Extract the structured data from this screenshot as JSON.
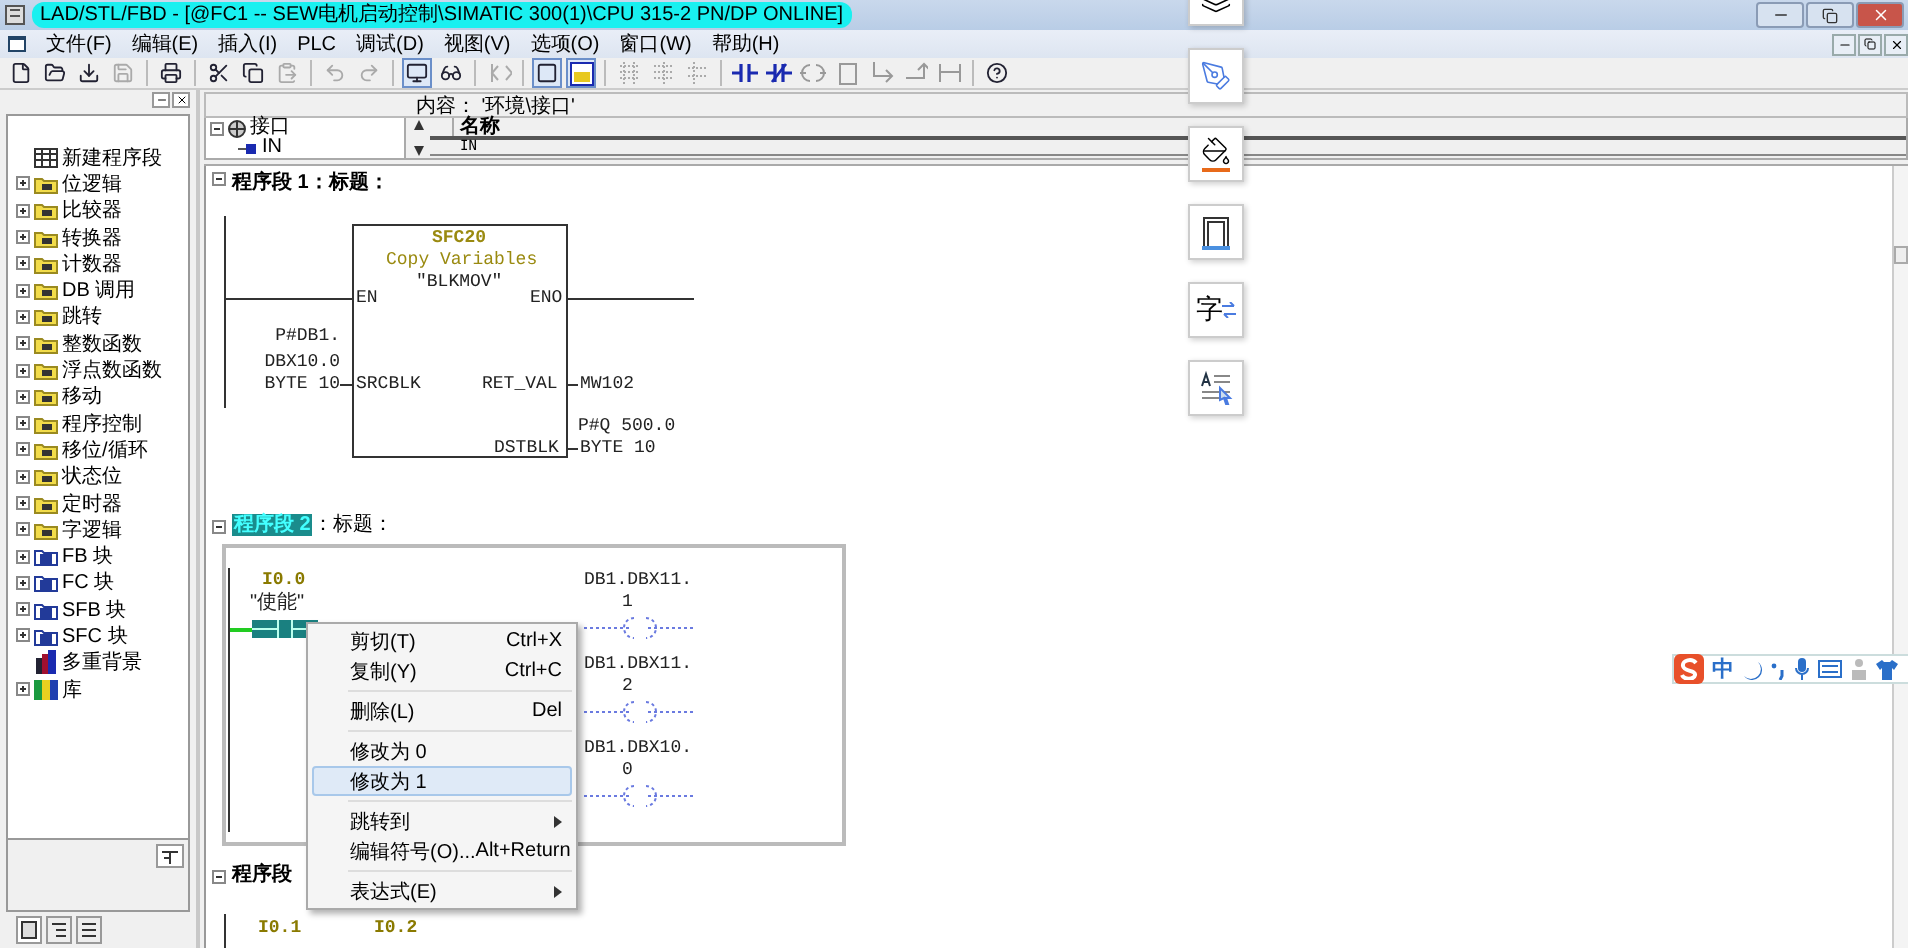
{
  "window": {
    "title": "LAD/STL/FBD  - [@FC1 -- SEW电机启动控制\\SIMATIC 300(1)\\CPU 315-2 PN/DP  ONLINE]"
  },
  "menu": [
    "文件(F)",
    "编辑(E)",
    "插入(I)",
    "PLC",
    "调试(D)",
    "视图(V)",
    "选项(O)",
    "窗口(W)",
    "帮助(H)"
  ],
  "catalog": {
    "items": [
      {
        "label": "新建程序段",
        "kind": "new"
      },
      {
        "label": "位逻辑",
        "kind": "folder"
      },
      {
        "label": "比较器",
        "kind": "folder"
      },
      {
        "label": "转换器",
        "kind": "folder"
      },
      {
        "label": "计数器",
        "kind": "folder"
      },
      {
        "label": "DB 调用",
        "kind": "folder"
      },
      {
        "label": "跳转",
        "kind": "folder"
      },
      {
        "label": "整数函数",
        "kind": "folder"
      },
      {
        "label": "浮点数函数",
        "kind": "folder"
      },
      {
        "label": "移动",
        "kind": "folder"
      },
      {
        "label": "程序控制",
        "kind": "folder"
      },
      {
        "label": "移位/循环",
        "kind": "folder"
      },
      {
        "label": "状态位",
        "kind": "folder"
      },
      {
        "label": "定时器",
        "kind": "folder"
      },
      {
        "label": "字逻辑",
        "kind": "folder"
      },
      {
        "label": "FB 块",
        "kind": "block"
      },
      {
        "label": "FC 块",
        "kind": "block"
      },
      {
        "label": "SFB 块",
        "kind": "block"
      },
      {
        "label": "SFC 块",
        "kind": "block"
      },
      {
        "label": "多重背景",
        "kind": "multi"
      },
      {
        "label": "库",
        "kind": "library"
      }
    ]
  },
  "details": {
    "content": "内容：  '环境\\接口'",
    "tree": {
      "label": "接口",
      "expanded": true,
      "children": [
        {
          "label": "IN"
        }
      ]
    },
    "columns": [
      "名称"
    ],
    "rows": [
      "IN"
    ]
  },
  "network_1": {
    "header": "程序段 1：标题：",
    "block": {
      "number": "SFC20",
      "name": "Copy Variables",
      "symbol": "\"BLKMOV\"",
      "en": "EN",
      "eno": "ENO",
      "srcblk": "SRCBLK",
      "ret_val": "RET_VAL",
      "dstblk": "DSTBLK"
    },
    "srcblk_operand": [
      "P#DB1.",
      "DBX10.0",
      "BYTE 10"
    ],
    "ret_val_operand": "MW102",
    "dstblk_operand": [
      "P#Q 500.0",
      "BYTE 10"
    ]
  },
  "network_2": {
    "number": "程序段 2",
    "selected": true,
    "title": "：标题：",
    "contact": {
      "address": "I0.0",
      "symbol": "\"使能\"",
      "selected": true
    },
    "coils": [
      {
        "address": "DB1.DBX11.",
        "bit": "1"
      },
      {
        "address": "DB1.DBX11.",
        "bit": "2"
      },
      {
        "address": "DB1.DBX10.",
        "bit": "0"
      }
    ]
  },
  "network_3": {
    "header": "程序段",
    "addresses": [
      "I0.1",
      "I0.2"
    ]
  },
  "context_menu": [
    {
      "kind": "item",
      "label": "剪切(T)",
      "shortcut": "Ctrl+X",
      "selected": false
    },
    {
      "kind": "item",
      "label": "复制(Y)",
      "shortcut": "Ctrl+C",
      "selected": false
    },
    {
      "kind": "separator"
    },
    {
      "kind": "item",
      "label": "删除(L)",
      "shortcut": "Del",
      "selected": false
    },
    {
      "kind": "separator"
    },
    {
      "kind": "item",
      "label": "修改为 0",
      "selected": false
    },
    {
      "kind": "item",
      "label": "修改为 1",
      "selected": true
    },
    {
      "kind": "separator"
    },
    {
      "kind": "submenu",
      "label": "跳转到",
      "selected": false
    },
    {
      "kind": "item",
      "label": "编辑符号(O)...",
      "shortcut": "Alt+Return",
      "selected": false
    },
    {
      "kind": "separator"
    },
    {
      "kind": "submenu",
      "label": "表达式(E)",
      "selected": false
    }
  ],
  "side_tools": {
    "translate_glyph": "字"
  },
  "ime_bar": {
    "mode": "中"
  }
}
